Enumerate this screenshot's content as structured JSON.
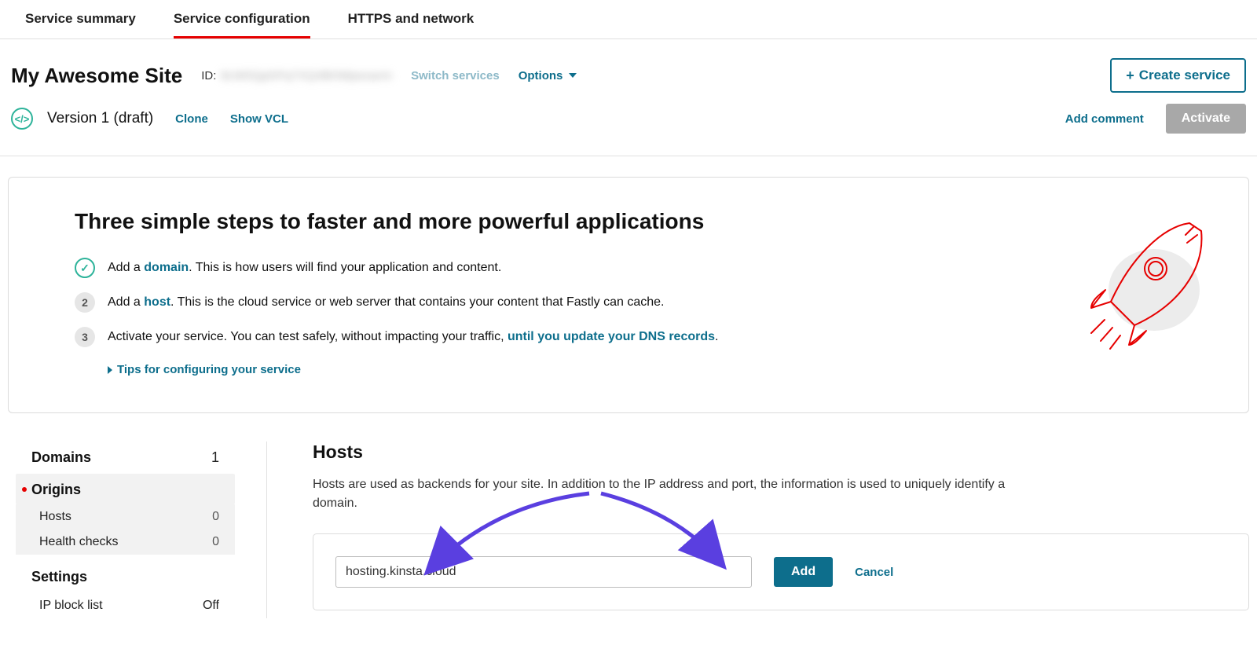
{
  "tabs": {
    "summary": "Service summary",
    "config": "Service configuration",
    "https": "HTTPS and network"
  },
  "service": {
    "title": "My Awesome Site",
    "id_label": "ID:",
    "id_value": "8cW5QphPq7XQ4BHMpesarm",
    "switch": "Switch services",
    "options": "Options",
    "create": "Create service"
  },
  "version": {
    "label": "Version 1 (draft)",
    "clone": "Clone",
    "show_vcl": "Show VCL",
    "add_comment": "Add comment",
    "activate": "Activate"
  },
  "onboard": {
    "heading": "Three simple steps to faster and more powerful applications",
    "step1_pre": "Add a ",
    "step1_link": "domain",
    "step1_post": ". This is how users will find your application and content.",
    "step2_pre": "Add a ",
    "step2_link": "host",
    "step2_post": ". This is the cloud service or web server that contains your content that Fastly can cache.",
    "step3_pre": "Activate your service. You can test safely, without impacting your traffic, ",
    "step3_link": "until you update your DNS records",
    "step3_post": ".",
    "tips": "Tips for configuring your service"
  },
  "sidebar": {
    "domains": {
      "label": "Domains",
      "count": "1"
    },
    "origins": {
      "label": "Origins"
    },
    "hosts": {
      "label": "Hosts",
      "count": "0"
    },
    "health": {
      "label": "Health checks",
      "count": "0"
    },
    "settings": {
      "label": "Settings"
    },
    "ipblock": {
      "label": "IP block list",
      "value": "Off"
    }
  },
  "hosts": {
    "title": "Hosts",
    "desc": "Hosts are used as backends for your site. In addition to the IP address and port, the information is used to uniquely identify a domain.",
    "input_value": "hosting.kinsta.cloud",
    "add": "Add",
    "cancel": "Cancel"
  }
}
